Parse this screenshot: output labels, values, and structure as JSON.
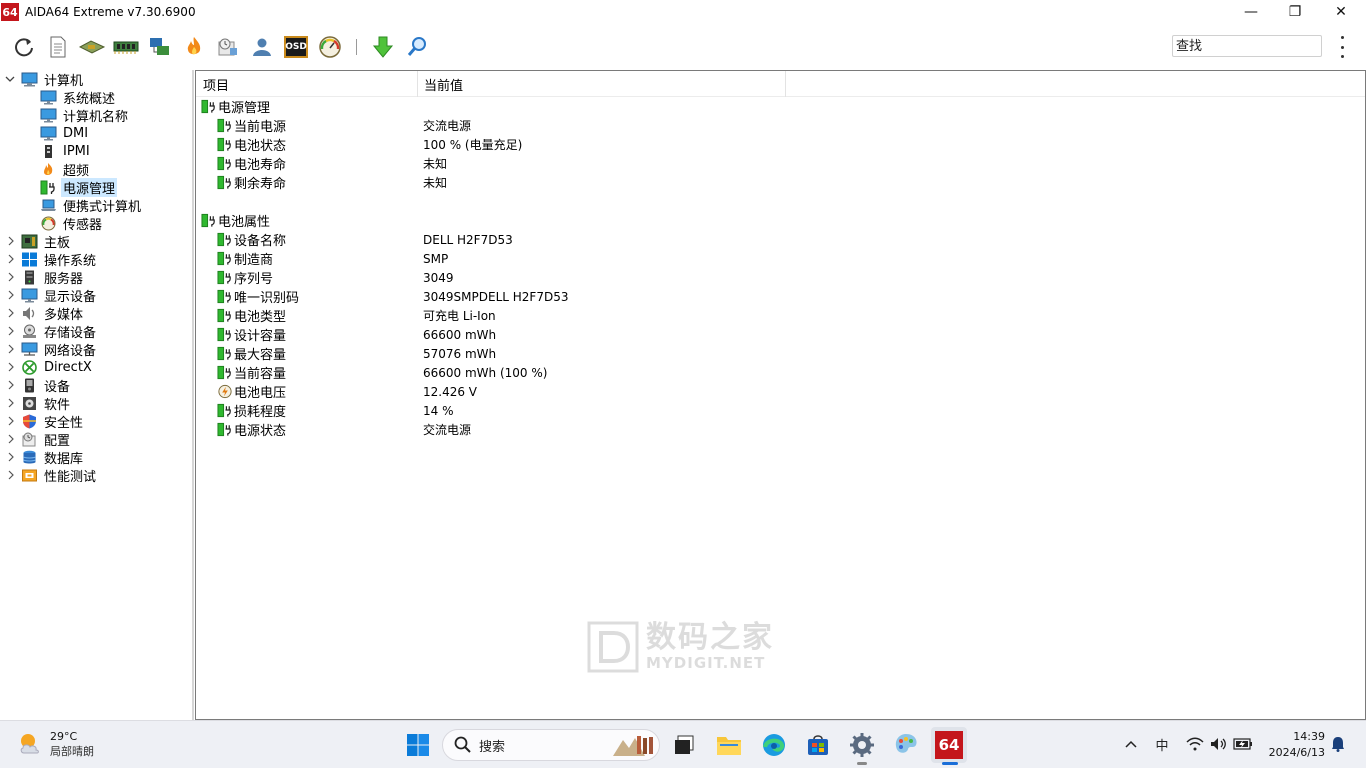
{
  "window": {
    "logo_text": "64",
    "title": "AIDA64 Extreme v7.30.6900",
    "minimize": "—",
    "restore": "❐",
    "close": "✕"
  },
  "toolbar": {
    "icons": [
      "refresh-icon",
      "report-icon",
      "motherboard-icon",
      "memory-icon",
      "network-icon",
      "flame-icon",
      "benchmark-icon",
      "user-icon",
      "osd-icon",
      "gauge-icon",
      "download-icon",
      "search-icon"
    ],
    "osd_label": "OSD",
    "search_placeholder": "查找"
  },
  "tree": {
    "root": "计算机",
    "children": [
      "系统概述",
      "计算机名称",
      "DMI",
      "IPMI",
      "超频",
      "电源管理",
      "便携式计算机",
      "传感器"
    ],
    "selected": "电源管理",
    "top_items": [
      "主板",
      "操作系统",
      "服务器",
      "显示设备",
      "多媒体",
      "存储设备",
      "网络设备",
      "DirectX",
      "设备",
      "软件",
      "安全性",
      "配置",
      "数据库",
      "性能测试"
    ]
  },
  "panel": {
    "col_item": "项目",
    "col_value": "当前值",
    "sections": [
      {
        "title": "电源管理",
        "rows": [
          {
            "label": "当前电源",
            "value": "交流电源"
          },
          {
            "label": "电池状态",
            "value": "100 % (电量充足)"
          },
          {
            "label": "电池寿命",
            "value": "未知"
          },
          {
            "label": "剩余寿命",
            "value": "未知"
          }
        ]
      },
      {
        "title": "电池属性",
        "rows": [
          {
            "label": "设备名称",
            "value": "DELL H2F7D53"
          },
          {
            "label": "制造商",
            "value": "SMP"
          },
          {
            "label": "序列号",
            "value": "3049"
          },
          {
            "label": "唯一识别码",
            "value": "3049SMPDELL H2F7D53"
          },
          {
            "label": "电池类型",
            "value": "可充电 Li-Ion"
          },
          {
            "label": "设计容量",
            "value": "66600 mWh"
          },
          {
            "label": "最大容量",
            "value": "57076 mWh"
          },
          {
            "label": "当前容量",
            "value": "66600 mWh  (100 %)"
          },
          {
            "label": "电池电压",
            "value": "12.426 V"
          },
          {
            "label": "损耗程度",
            "value": "14 %"
          },
          {
            "label": "电源状态",
            "value": "交流电源"
          }
        ]
      }
    ]
  },
  "watermark": {
    "line1": "数码之家",
    "line2": "MYDIGIT.NET"
  },
  "taskbar": {
    "temperature": "29°C",
    "weather": "局部晴朗",
    "search_label": "搜索",
    "ime": "中",
    "time": "14:39",
    "date": "2024/6/13"
  },
  "colors": {
    "selection": "#cce8ff",
    "battery_green": "#2fb82f",
    "logo_red": "#c4161c",
    "taskbar_bg": "#eef0f5"
  }
}
